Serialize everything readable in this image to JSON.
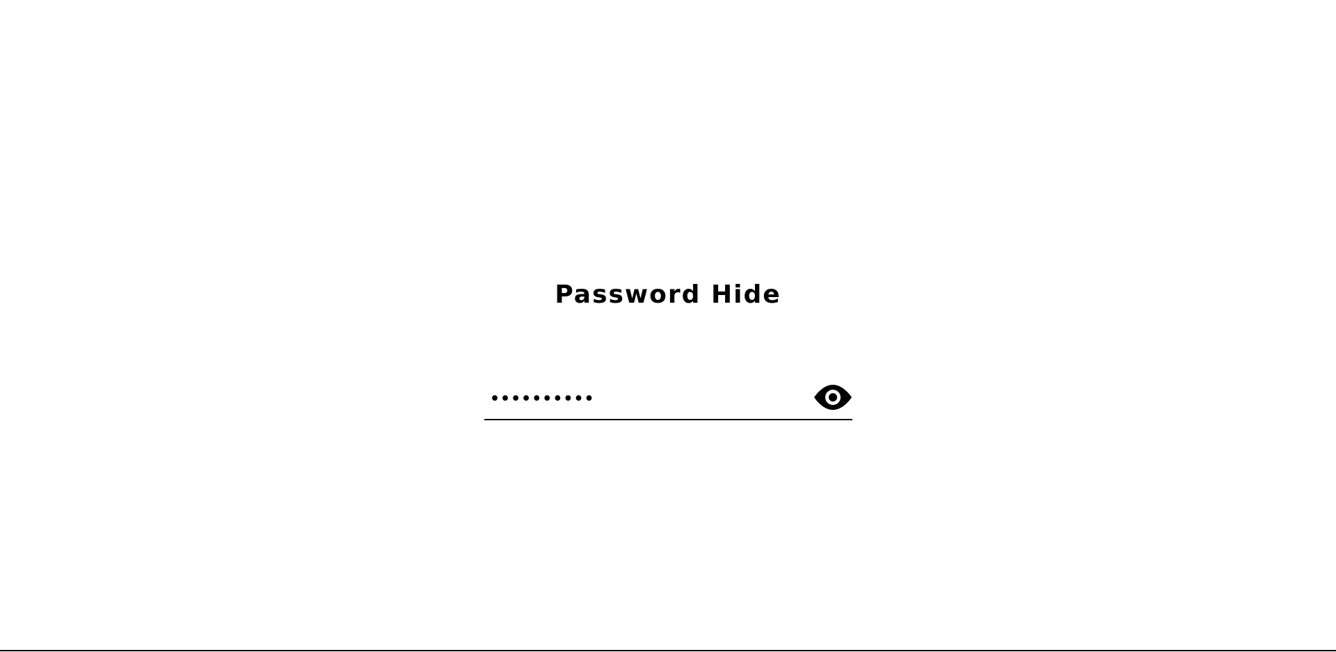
{
  "page": {
    "title": "Password Hide"
  },
  "password_field": {
    "value": "password12",
    "type": "password"
  },
  "toggle": {
    "icon": "eye-icon"
  },
  "colors": {
    "background": "#ffffff",
    "text": "#000000",
    "line": "#000000"
  }
}
